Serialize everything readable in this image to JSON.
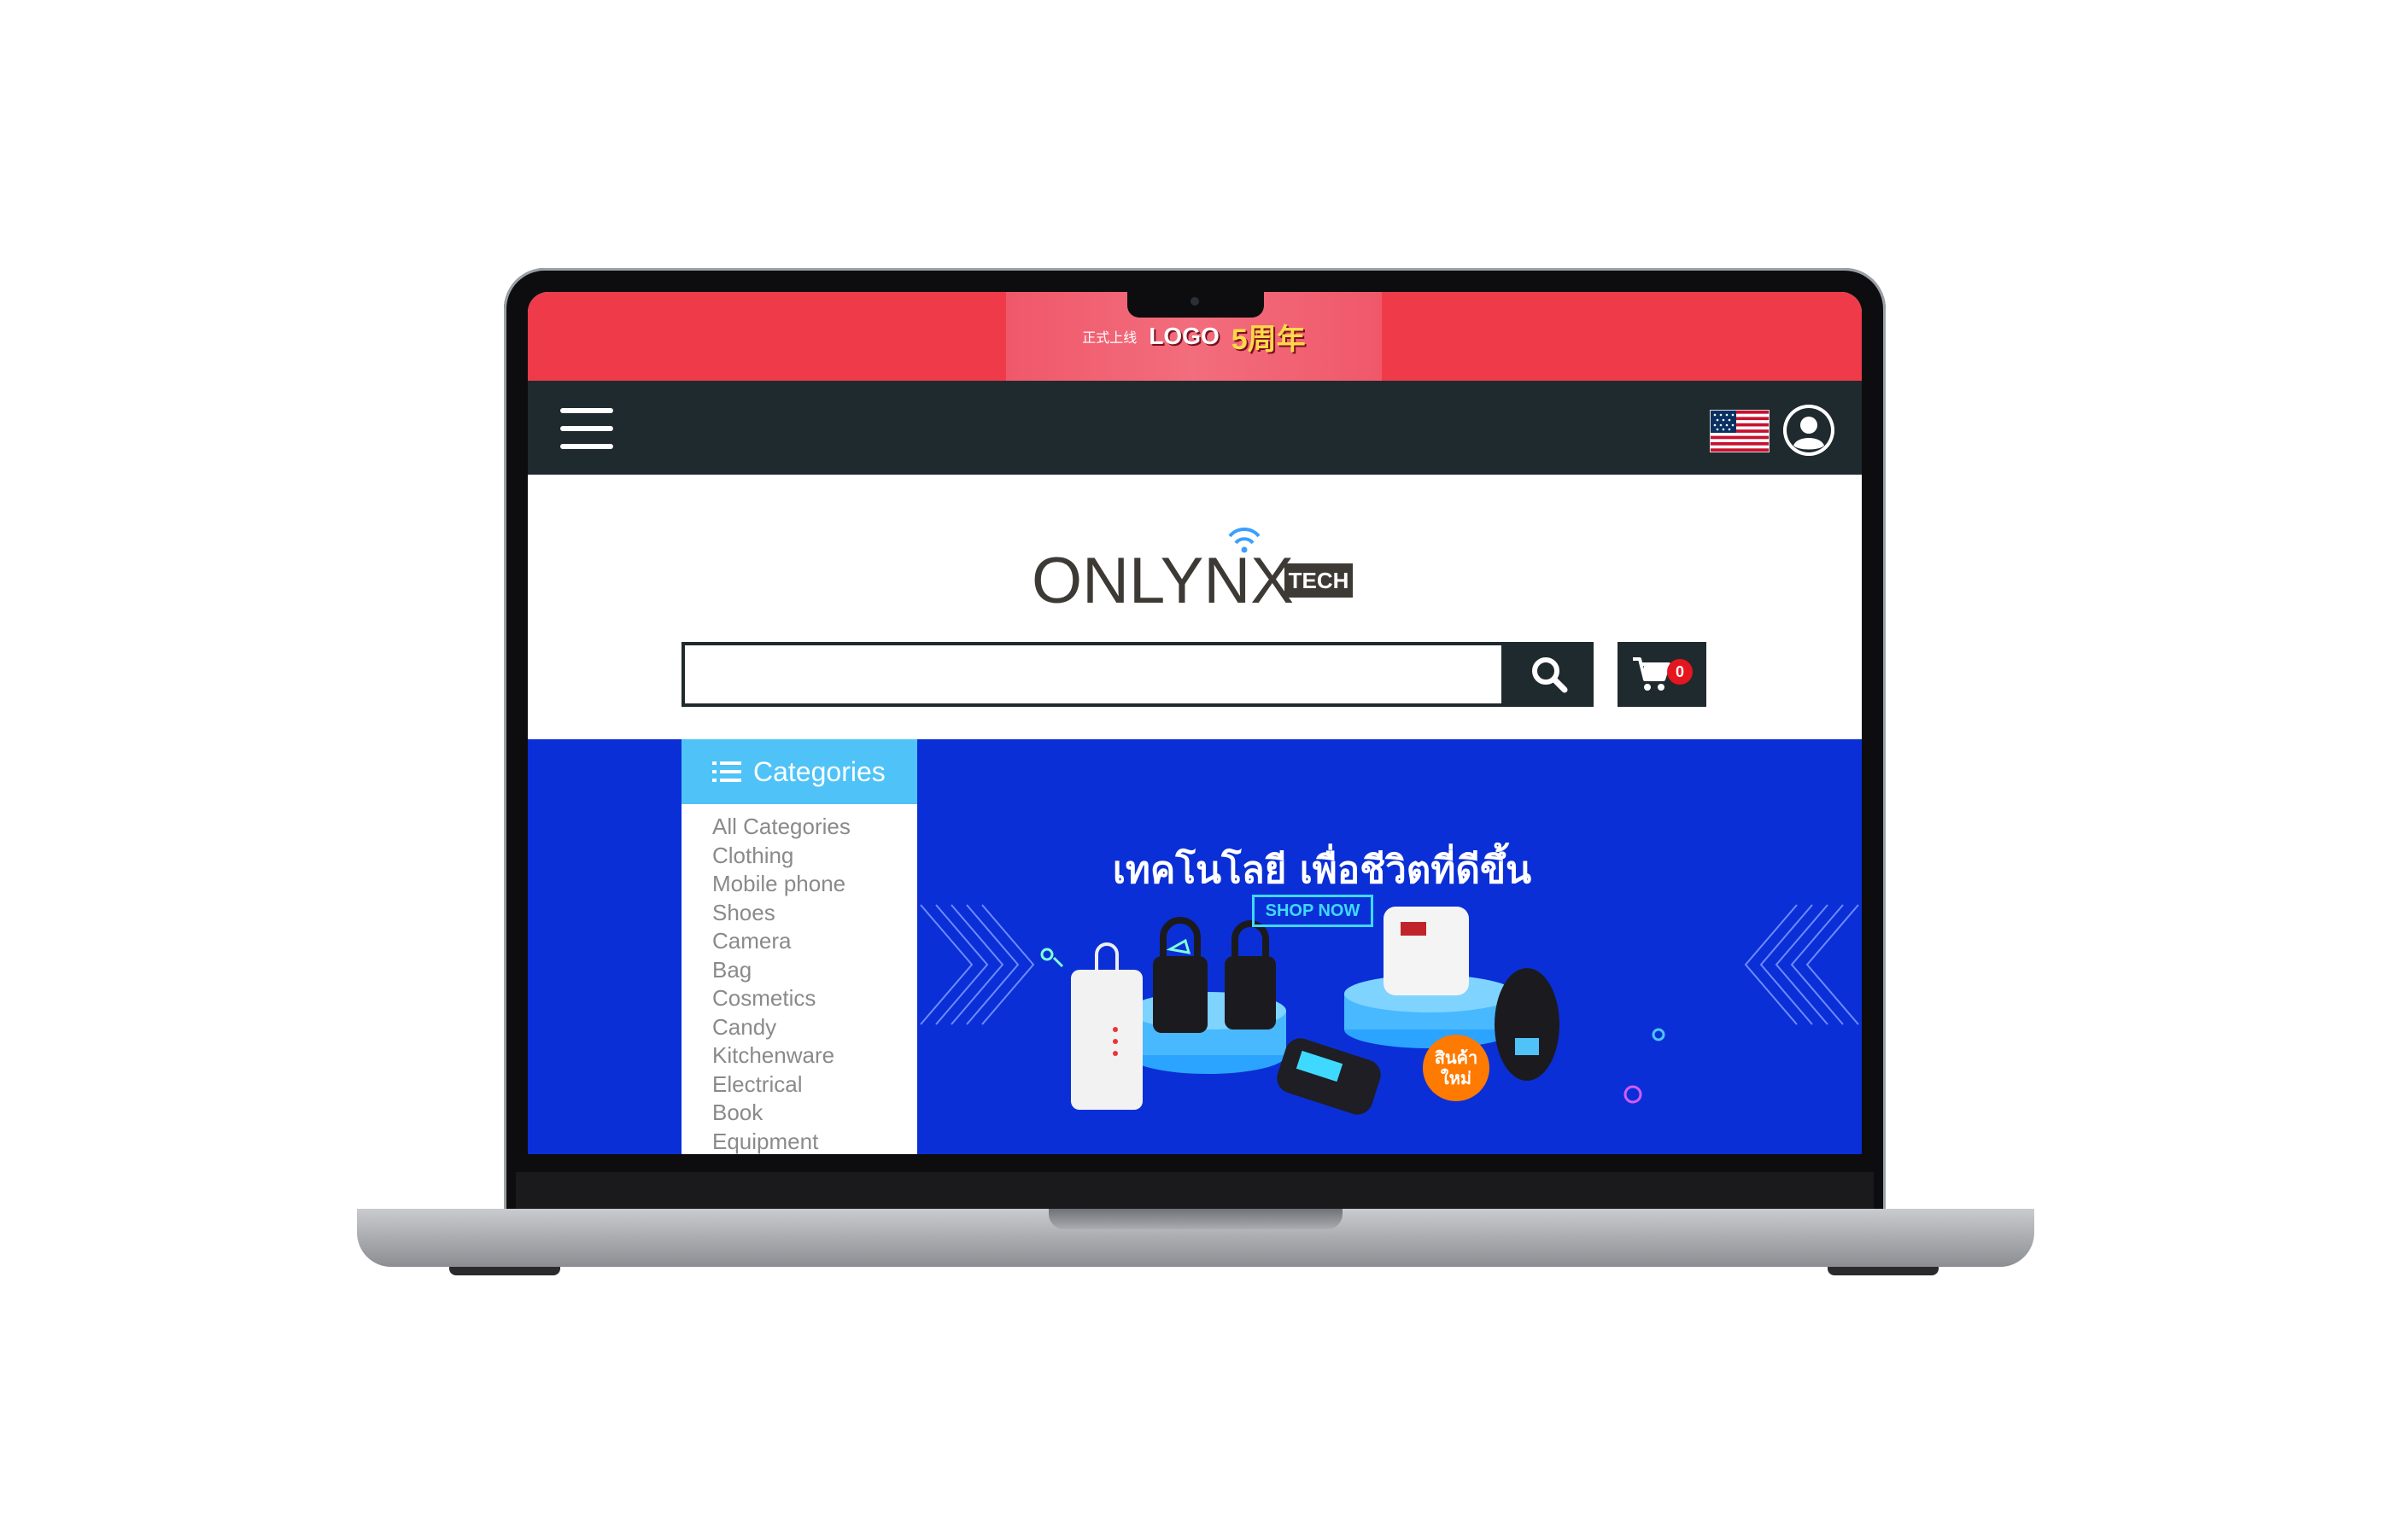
{
  "promo": {
    "line1": "LOGO",
    "line2": "5周年",
    "line3": "正式上线"
  },
  "navbar": {
    "menu_icon": "hamburger-menu-icon",
    "language_icon": "us-flag-icon",
    "account_icon": "user-circle-icon"
  },
  "header": {
    "logo_text": "ONLYNX",
    "logo_suffix": "TECH",
    "search_placeholder": "",
    "search_icon": "search-icon",
    "cart_icon": "cart-icon",
    "cart_count": "0"
  },
  "categories": {
    "title": "Categories",
    "items": [
      "All Categories",
      "Clothing",
      "Mobile phone",
      "Shoes",
      "Camera",
      "Bag",
      "Cosmetics",
      "Candy",
      "Kitchenware",
      "Electrical",
      "Book",
      "Equipment"
    ]
  },
  "banner": {
    "headline": "เทคโนโลยี เพื่อชีวิตที่ดีขึ้น",
    "cta": "SHOP NOW",
    "badge": "สินค้าใหม่"
  },
  "colors": {
    "promo_red": "#ef3a4a",
    "nav_dark": "#1f2a2e",
    "hero_blue": "#0b2fd6",
    "categories_header": "#4fc3f7",
    "cart_badge": "#e5161e",
    "cta": "#3fd9ff"
  }
}
